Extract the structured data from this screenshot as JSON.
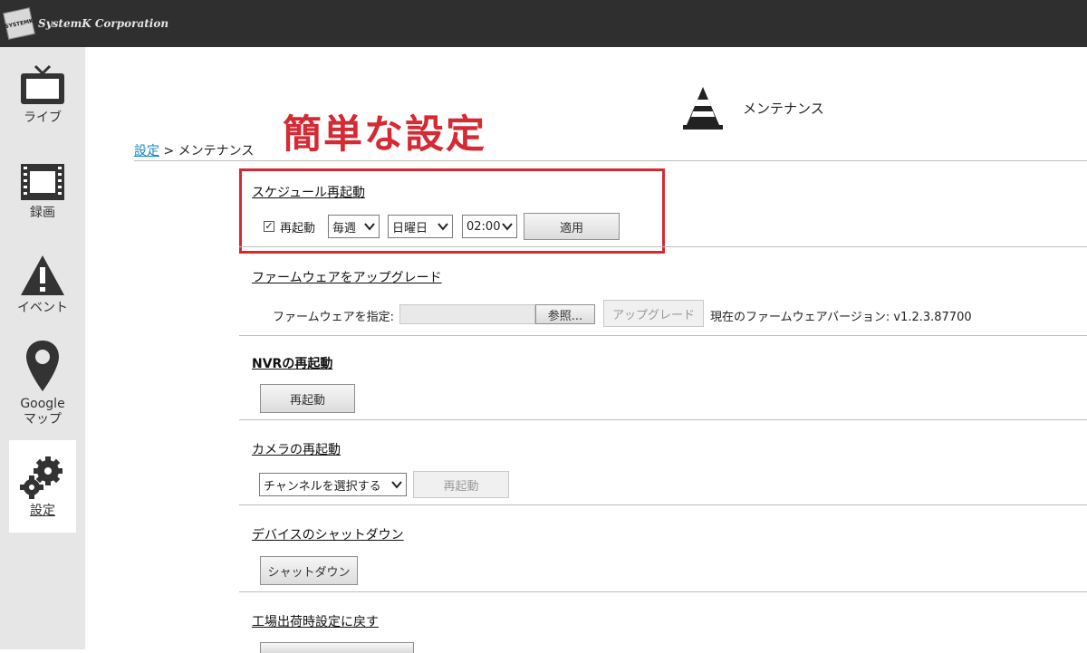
{
  "header": {
    "logo_text": "SystemK Corporation",
    "logo_mark": "SYSTEMK"
  },
  "sidebar": {
    "items": [
      {
        "label": "ライブ",
        "icon": "tv-icon"
      },
      {
        "label": "録画",
        "icon": "film-icon"
      },
      {
        "label": "イベント",
        "icon": "warning-icon"
      },
      {
        "label": "Google\nマップ",
        "label_line1": "Google",
        "label_line2": "マップ",
        "icon": "map-pin-icon"
      },
      {
        "label": "設定",
        "icon": "gears-icon",
        "active": true
      }
    ]
  },
  "annotation": {
    "headline": "簡単な設定",
    "color": "#d42a34"
  },
  "page": {
    "title": "メンテナンス",
    "icon": "traffic-cone-icon"
  },
  "breadcrumb": {
    "link": "設定",
    "separator": ">",
    "current": "メンテナンス"
  },
  "schedule": {
    "title": "スケジュール再起動",
    "checkbox_label": "再起動",
    "checked": true,
    "frequency": "毎週",
    "day": "日曜日",
    "time": "02:00",
    "apply_label": "適用"
  },
  "firmware": {
    "title": "ファームウェアをアップグレード",
    "specify_label": "ファームウェアを指定:",
    "browse_label": "参照...",
    "upgrade_label": "アップグレード",
    "current_label": "現在のファームウェアバージョン:",
    "current_version": "v1.2.3.87700"
  },
  "nvr_restart": {
    "title": "NVRの再起動",
    "button_label": "再起動"
  },
  "camera_restart": {
    "title": "カメラの再起動",
    "select_placeholder": "チャンネルを選択する",
    "button_label": "再起動"
  },
  "shutdown": {
    "title": "デバイスのシャットダウン",
    "button_label": "シャットダウン"
  },
  "factory_reset": {
    "title": "工場出荷時設定に戻す"
  }
}
